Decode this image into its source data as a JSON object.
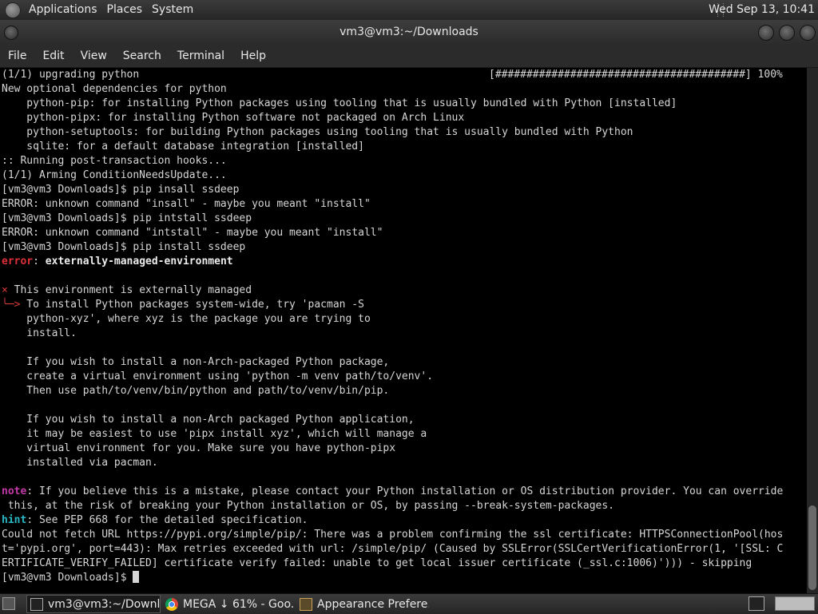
{
  "top_panel": {
    "menus": [
      "Applications",
      "Places",
      "System"
    ],
    "clock": "Wed Sep 13, 10:41"
  },
  "window": {
    "title": "vm3@vm3:~/Downloads",
    "menu": [
      "File",
      "Edit",
      "View",
      "Search",
      "Terminal",
      "Help"
    ]
  },
  "terminal": {
    "progress": "[########################################] 100%",
    "lines": [
      [
        {
          "t": "(1/1) upgrading python"
        }
      ],
      [
        {
          "t": "New optional dependencies for python"
        }
      ],
      [
        {
          "t": "    python-pip: for installing Python packages using tooling that is usually bundled with Python [installed]"
        }
      ],
      [
        {
          "t": "    python-pipx: for installing Python software not packaged on Arch Linux"
        }
      ],
      [
        {
          "t": "    python-setuptools: for building Python packages using tooling that is usually bundled with Python"
        }
      ],
      [
        {
          "t": "    sqlite: for a default database integration [installed]"
        }
      ],
      [
        {
          "t": ":: Running post-transaction hooks..."
        }
      ],
      [
        {
          "t": "(1/1) Arming ConditionNeedsUpdate..."
        }
      ],
      [
        {
          "t": "[vm3@vm3 Downloads]$ pip insall ssdeep"
        }
      ],
      [
        {
          "t": "ERROR: unknown command \"insall\" - maybe you meant \"install\""
        }
      ],
      [
        {
          "t": "[vm3@vm3 Downloads]$ pip intstall ssdeep"
        }
      ],
      [
        {
          "t": "ERROR: unknown command \"intstall\" - maybe you meant \"install\""
        }
      ],
      [
        {
          "t": "[vm3@vm3 Downloads]$ pip install ssdeep"
        }
      ],
      [
        {
          "t": "error",
          "c": "red"
        },
        {
          "t": ": "
        },
        {
          "t": "externally-managed-environment",
          "c": "bold"
        }
      ],
      [
        {
          "t": ""
        }
      ],
      [
        {
          "t": "×",
          "c": "redn"
        },
        {
          "t": " This environment is externally managed"
        }
      ],
      [
        {
          "t": "╰─>",
          "c": "redn"
        },
        {
          "t": " To install Python packages system-wide, try 'pacman -S"
        }
      ],
      [
        {
          "t": "    python-xyz', where xyz is the package you are trying to"
        }
      ],
      [
        {
          "t": "    install."
        }
      ],
      [
        {
          "t": ""
        }
      ],
      [
        {
          "t": "    If you wish to install a non-Arch-packaged Python package,"
        }
      ],
      [
        {
          "t": "    create a virtual environment using 'python -m venv path/to/venv'."
        }
      ],
      [
        {
          "t": "    Then use path/to/venv/bin/python and path/to/venv/bin/pip."
        }
      ],
      [
        {
          "t": ""
        }
      ],
      [
        {
          "t": "    If you wish to install a non-Arch packaged Python application,"
        }
      ],
      [
        {
          "t": "    it may be easiest to use 'pipx install xyz', which will manage a"
        }
      ],
      [
        {
          "t": "    virtual environment for you. Make sure you have python-pipx"
        }
      ],
      [
        {
          "t": "    installed via pacman."
        }
      ],
      [
        {
          "t": ""
        }
      ],
      [
        {
          "t": "note",
          "c": "magenta"
        },
        {
          "t": ": If you believe this is a mistake, please contact your Python installation or OS distribution provider. You can override"
        }
      ],
      [
        {
          "t": " this, at the risk of breaking your Python installation or OS, by passing --break-system-packages."
        }
      ],
      [
        {
          "t": "hint",
          "c": "cyan"
        },
        {
          "t": ": See PEP 668 for the detailed specification."
        }
      ],
      [
        {
          "t": "Could not fetch URL https://pypi.org/simple/pip/: There was a problem confirming the ssl certificate: HTTPSConnectionPool(hos"
        }
      ],
      [
        {
          "t": "t='pypi.org', port=443): Max retries exceeded with url: /simple/pip/ (Caused by SSLError(SSLCertVerificationError(1, '[SSL: C"
        }
      ],
      [
        {
          "t": "ERTIFICATE_VERIFY_FAILED] certificate verify failed: unable to get local issuer certificate (_ssl.c:1006)'))) - skipping"
        }
      ],
      [
        {
          "t": "[vm3@vm3 Downloads]$ "
        }
      ]
    ]
  },
  "taskbar": {
    "tasks": [
      {
        "label": "vm3@vm3:~/Downl...",
        "icon": "terminal-icon"
      },
      {
        "label": "MEGA ↓ 61% - Goo...",
        "icon": "chrome-icon"
      },
      {
        "label": "Appearance Prefere...",
        "icon": "appearance-icon"
      }
    ]
  }
}
